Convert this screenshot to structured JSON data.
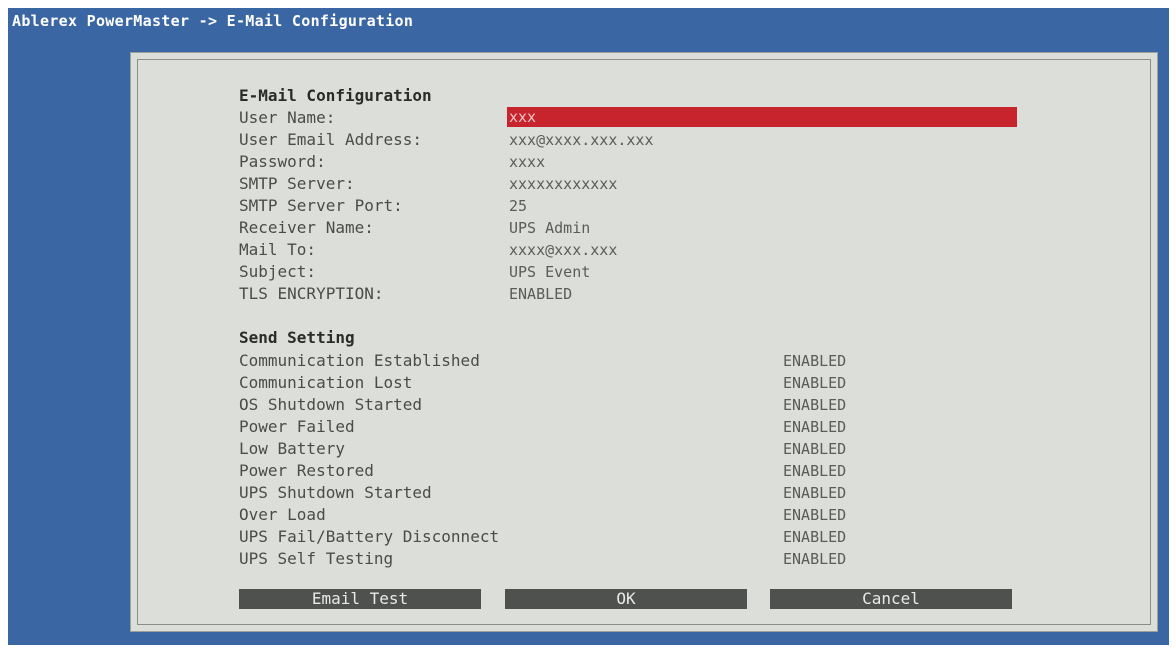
{
  "window_title": "Ablerex PowerMaster -> E-Mail Configuration",
  "email_section": {
    "heading": "E-Mail Configuration",
    "fields": [
      {
        "label": "User Name:",
        "value": "xxx"
      },
      {
        "label": "User Email Address:",
        "value": "xxx@xxxx.xxx.xxx"
      },
      {
        "label": "Password:",
        "value": "xxxx"
      },
      {
        "label": "SMTP Server:",
        "value": "xxxxxxxxxxxx"
      },
      {
        "label": "SMTP Server Port:",
        "value": "25"
      },
      {
        "label": "Receiver Name:",
        "value": "UPS Admin"
      },
      {
        "label": "Mail To:",
        "value": "xxxx@xxx.xxx"
      },
      {
        "label": "Subject:",
        "value": "UPS Event"
      },
      {
        "label": "TLS ENCRYPTION:",
        "value": "ENABLED"
      }
    ]
  },
  "send_section": {
    "heading": "Send Setting",
    "items": [
      {
        "label": "Communication Established",
        "status": "ENABLED"
      },
      {
        "label": "Communication Lost",
        "status": "ENABLED"
      },
      {
        "label": "OS Shutdown Started",
        "status": "ENABLED"
      },
      {
        "label": "Power Failed",
        "status": "ENABLED"
      },
      {
        "label": "Low Battery",
        "status": "ENABLED"
      },
      {
        "label": "Power Restored",
        "status": "ENABLED"
      },
      {
        "label": "UPS Shutdown Started",
        "status": "ENABLED"
      },
      {
        "label": "Over Load",
        "status": "ENABLED"
      },
      {
        "label": "UPS Fail/Battery Disconnect",
        "status": "ENABLED"
      },
      {
        "label": "UPS Self Testing",
        "status": "ENABLED"
      }
    ]
  },
  "buttons": {
    "email_test": "Email Test",
    "ok": "OK",
    "cancel": "Cancel"
  },
  "colors": {
    "background_blue": "#3a66a3",
    "dialog_gray": "#dcded9",
    "active_field_red": "#c8242e",
    "button_dark": "#4f514f"
  }
}
